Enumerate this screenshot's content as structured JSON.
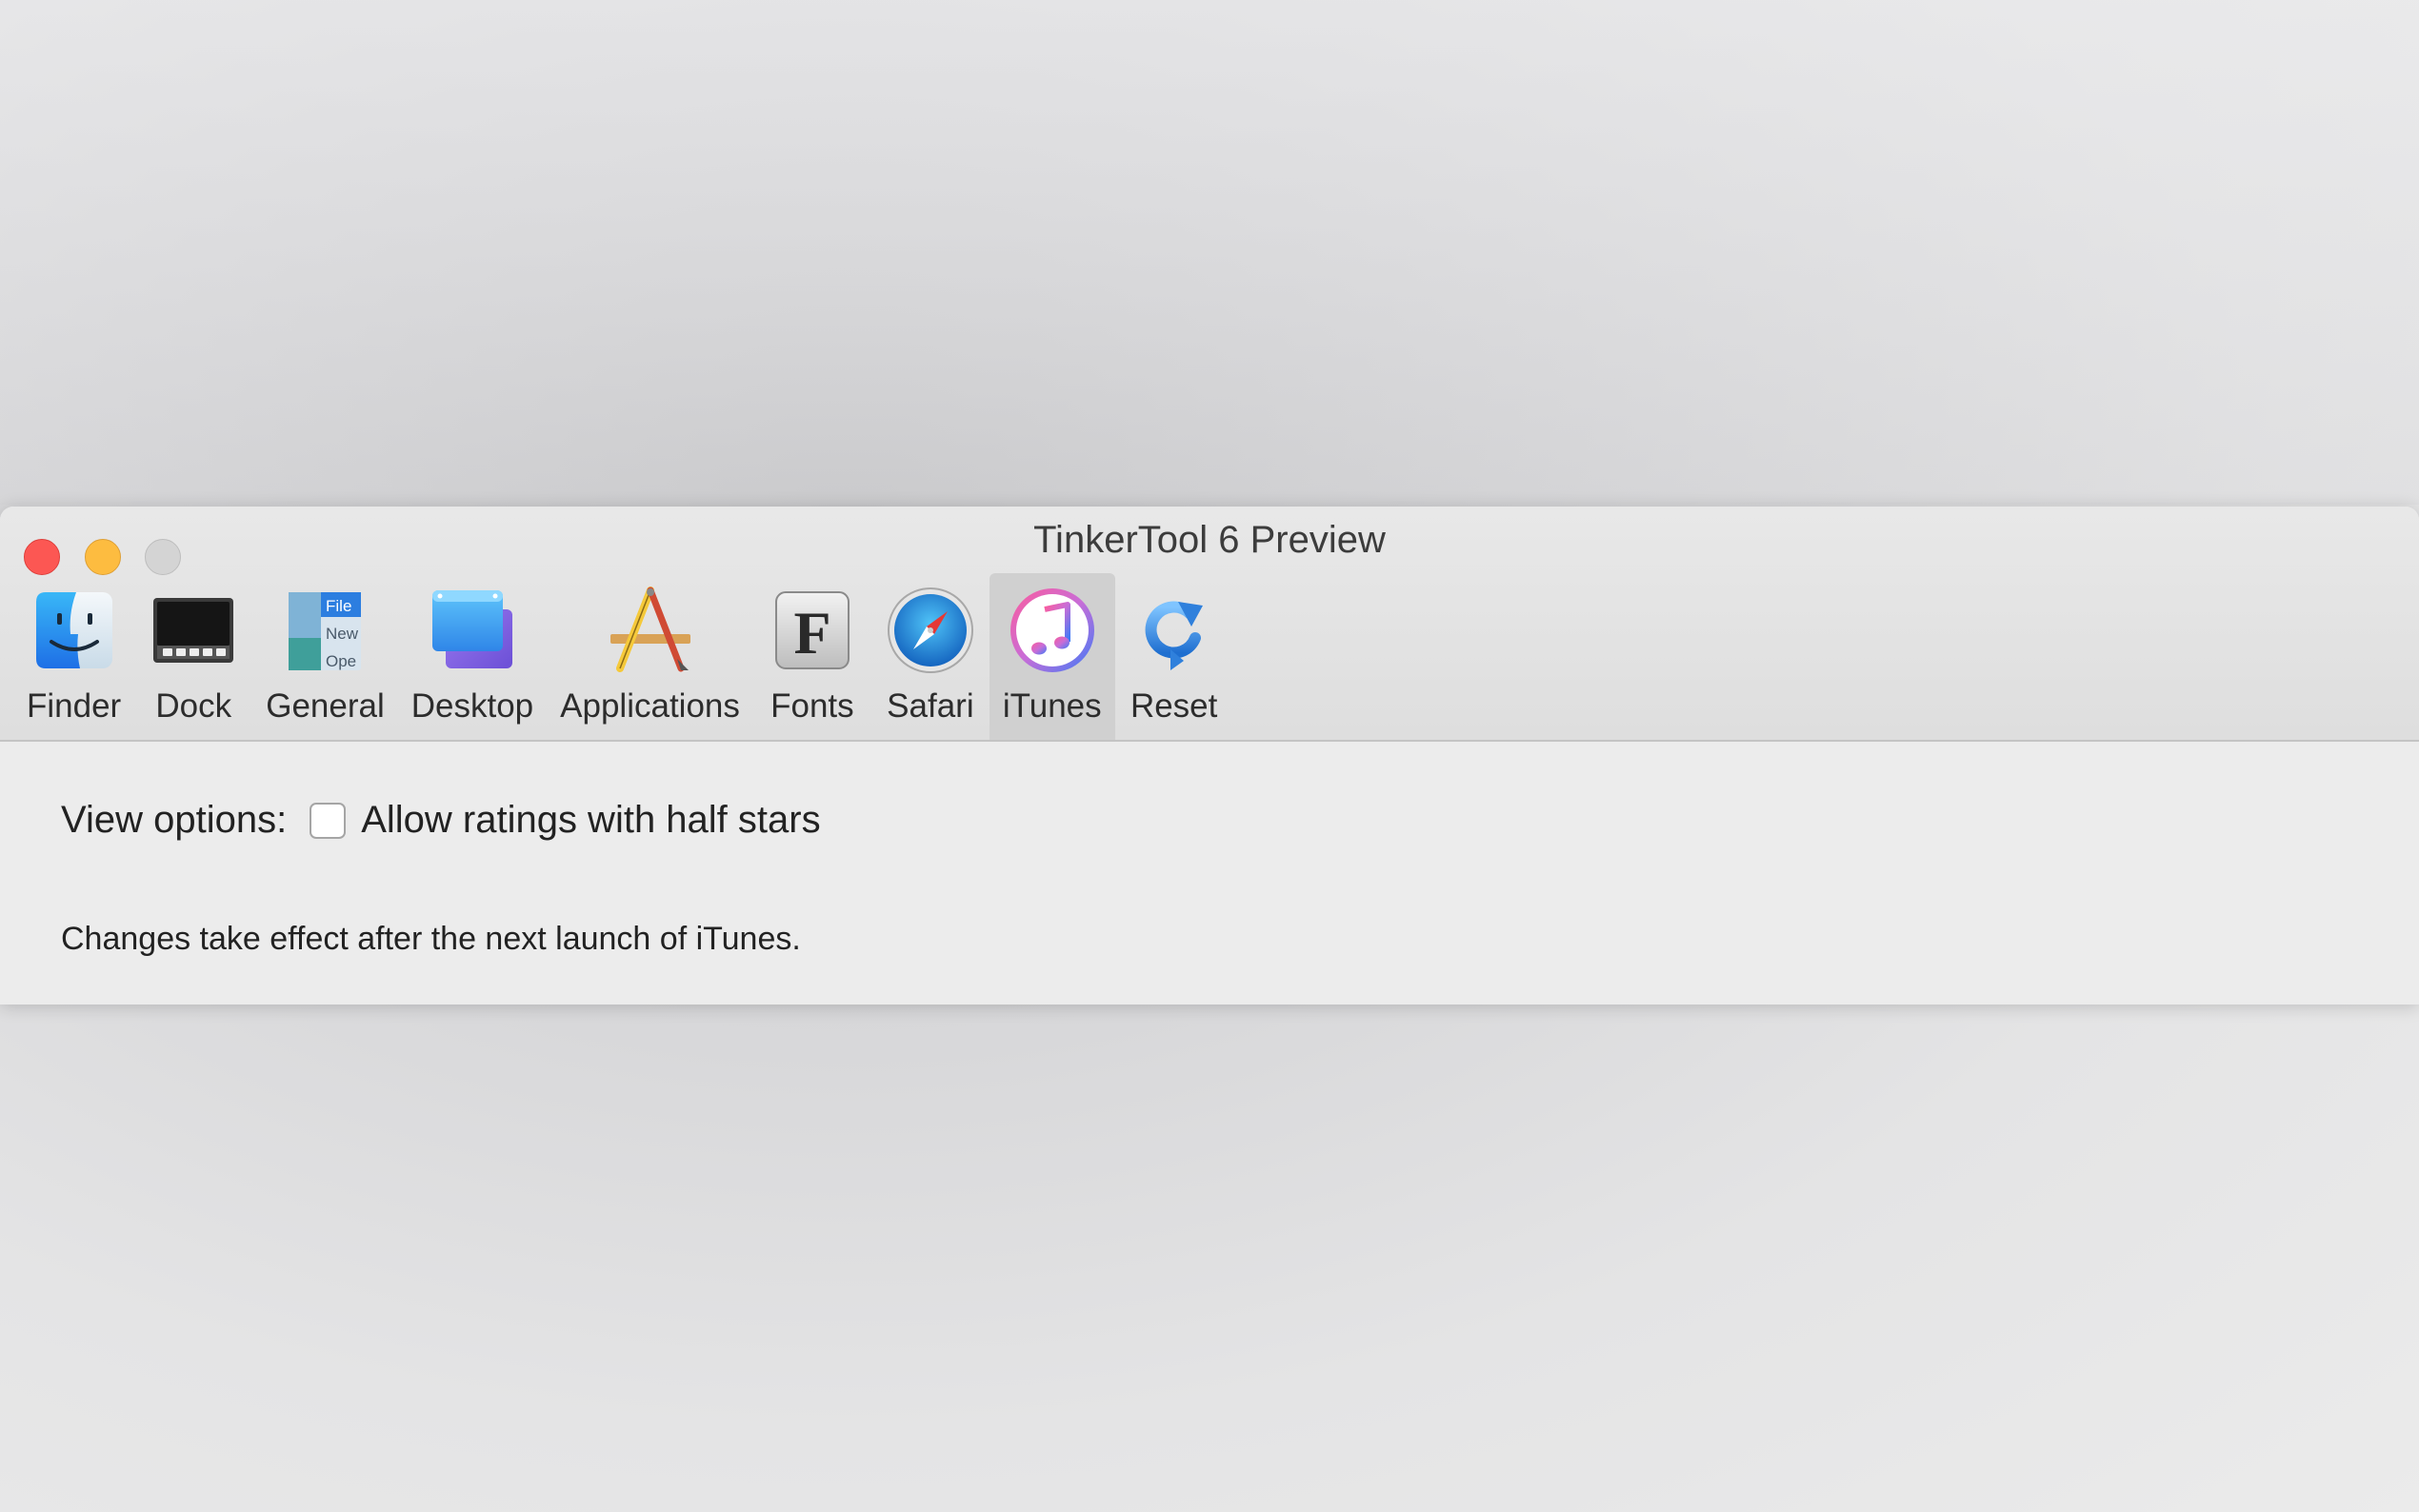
{
  "window": {
    "title": "TinkerTool 6 Preview"
  },
  "toolbar": {
    "items": [
      {
        "label": "Finder",
        "icon": "finder-icon"
      },
      {
        "label": "Dock",
        "icon": "dock-icon"
      },
      {
        "label": "General",
        "icon": "general-icon"
      },
      {
        "label": "Desktop",
        "icon": "desktop-icon"
      },
      {
        "label": "Applications",
        "icon": "applications-icon"
      },
      {
        "label": "Fonts",
        "icon": "fonts-icon"
      },
      {
        "label": "Safari",
        "icon": "safari-icon"
      },
      {
        "label": "iTunes",
        "icon": "itunes-icon",
        "selected": true
      },
      {
        "label": "Reset",
        "icon": "reset-icon"
      }
    ],
    "general_icon_text": [
      "File",
      "New",
      "Ope"
    ],
    "fonts_icon_glyph": "F"
  },
  "content": {
    "view_options_label": "View options:",
    "half_stars": {
      "label": "Allow ratings with half stars",
      "checked": false
    },
    "note": "Changes take effect after the next launch of iTunes."
  },
  "colors": {
    "close": "#fc5753",
    "minimize": "#fdbc40",
    "zoom": "#d4d4d4",
    "selected_tab": "#d0d0d0"
  }
}
